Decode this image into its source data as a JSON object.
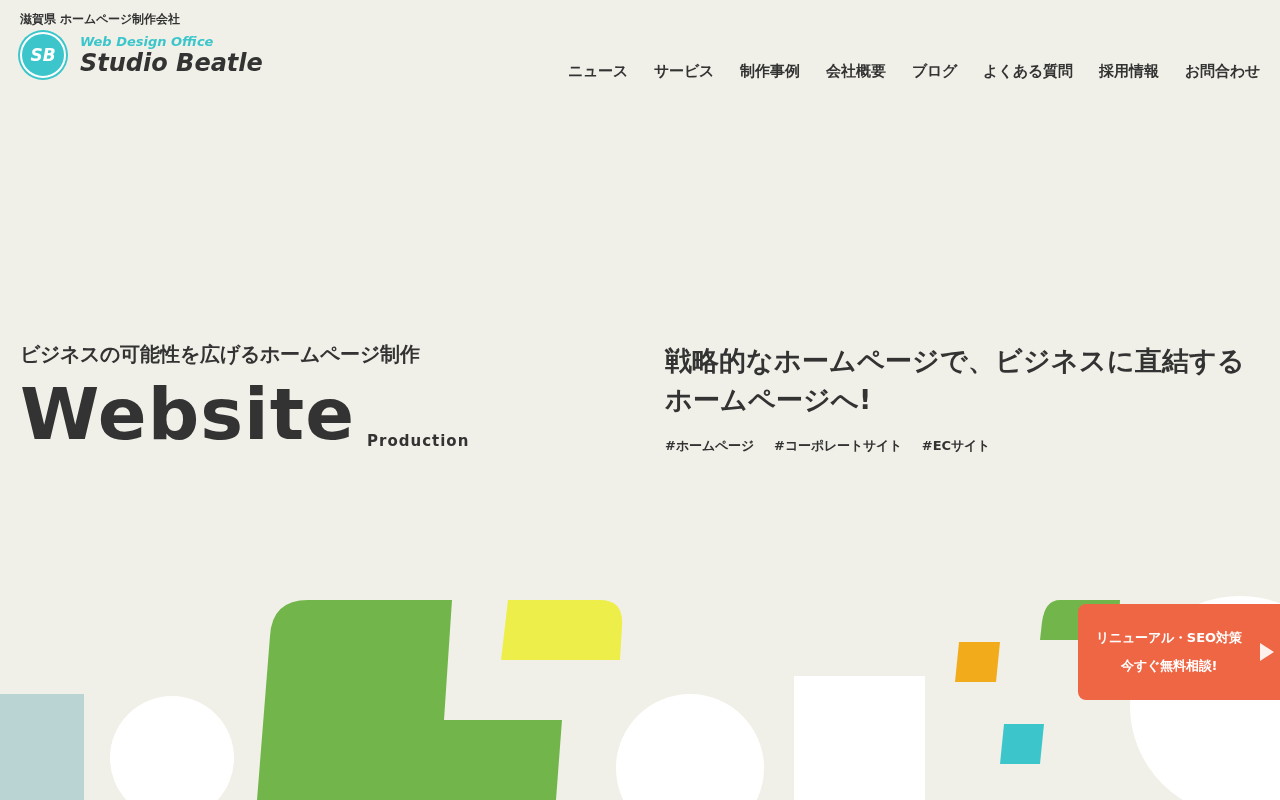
{
  "header": {
    "tagline": "滋賀県 ホームページ制作会社",
    "logo": {
      "mark": "SB",
      "subtitle": "Web Design Office",
      "name": "Studio Beatle"
    },
    "nav": [
      "ニュース",
      "サービス",
      "制作事例",
      "会社概要",
      "ブログ",
      "よくある質問",
      "採用情報",
      "お問合わせ"
    ]
  },
  "hero": {
    "lead": "ビジネスの可能性を広げるホームページ制作",
    "title": "Website",
    "title_suffix": "Production",
    "headline": "戦略的なホームページで、ビジネスに直結するホームページへ!",
    "tags": [
      "#ホームページ",
      "#コーポレートサイト",
      "#ECサイト"
    ]
  },
  "cta": {
    "line_1": "リニューアル・SEO対策",
    "line_2": "今すぐ無料相談!"
  }
}
